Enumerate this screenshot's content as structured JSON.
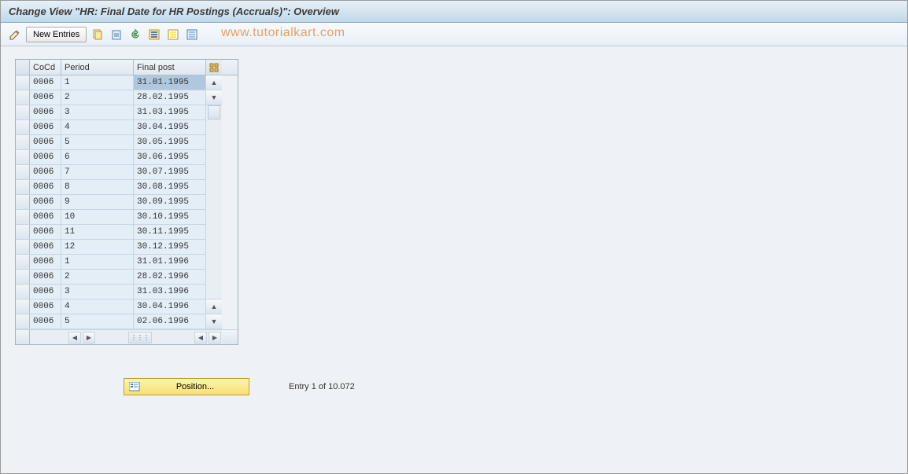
{
  "title": "Change View \"HR: Final Date for HR Postings (Accruals)\": Overview",
  "toolbar": {
    "new_entries": "New Entries"
  },
  "watermark": "www.tutorialkart.com",
  "table": {
    "headers": {
      "cocd": "CoCd",
      "period": "Period",
      "final": "Final post"
    },
    "rows": [
      {
        "cocd": "0006",
        "period": "1",
        "final": "31.01.1995",
        "highlighted": true
      },
      {
        "cocd": "0006",
        "period": "2",
        "final": "28.02.1995"
      },
      {
        "cocd": "0006",
        "period": "3",
        "final": "31.03.1995"
      },
      {
        "cocd": "0006",
        "period": "4",
        "final": "30.04.1995"
      },
      {
        "cocd": "0006",
        "period": "5",
        "final": "30.05.1995"
      },
      {
        "cocd": "0006",
        "period": "6",
        "final": "30.06.1995"
      },
      {
        "cocd": "0006",
        "period": "7",
        "final": "30.07.1995"
      },
      {
        "cocd": "0006",
        "period": "8",
        "final": "30.08.1995"
      },
      {
        "cocd": "0006",
        "period": "9",
        "final": "30.09.1995"
      },
      {
        "cocd": "0006",
        "period": "10",
        "final": "30.10.1995"
      },
      {
        "cocd": "0006",
        "period": "11",
        "final": "30.11.1995"
      },
      {
        "cocd": "0006",
        "period": "12",
        "final": "30.12.1995"
      },
      {
        "cocd": "0006",
        "period": "1",
        "final": "31.01.1996"
      },
      {
        "cocd": "0006",
        "period": "2",
        "final": "28.02.1996"
      },
      {
        "cocd": "0006",
        "period": "3",
        "final": "31.03.1996"
      },
      {
        "cocd": "0006",
        "period": "4",
        "final": "30.04.1996"
      },
      {
        "cocd": "0006",
        "period": "5",
        "final": "02.06.1996"
      }
    ]
  },
  "footer": {
    "position_label": "Position...",
    "entry_text": "Entry 1 of 10.072"
  }
}
